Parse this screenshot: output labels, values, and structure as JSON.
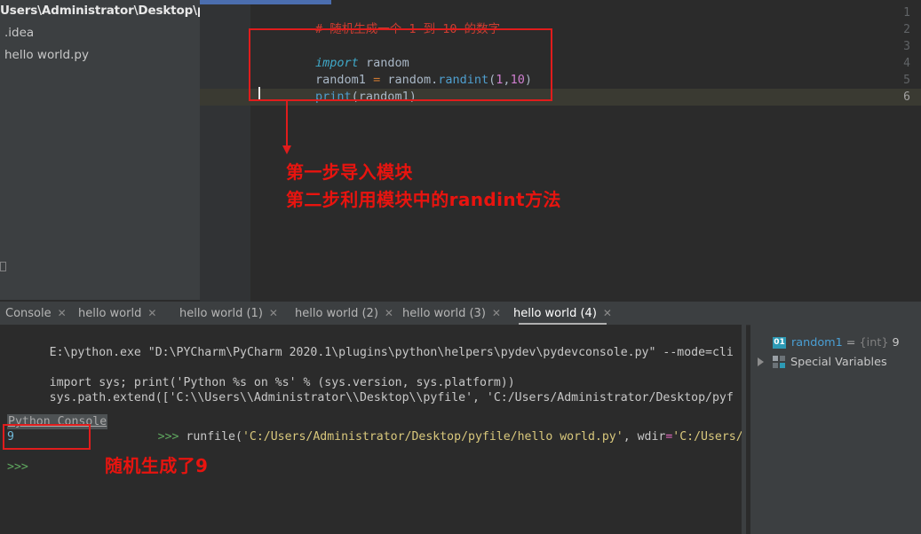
{
  "project_tree": {
    "root": "Users\\Administrator\\Desktop\\pyfile",
    "items": [
      {
        "label": ".idea"
      },
      {
        "label": "hello world.py"
      }
    ]
  },
  "editor": {
    "line_numbers": [
      "1",
      "2",
      "3",
      "4",
      "5",
      "6"
    ],
    "lines": [
      {
        "n": "1",
        "tokens": [
          {
            "t": "# 随机生成一个 1 到 10 的数字",
            "c": "tok-comment"
          }
        ]
      },
      {
        "n": "2",
        "tokens": []
      },
      {
        "n": "3",
        "tokens": [
          {
            "t": "import",
            "c": "tok-kw"
          },
          {
            "t": " random",
            "c": "tok-plain"
          }
        ]
      },
      {
        "n": "4",
        "tokens": [
          {
            "t": "random1 ",
            "c": "tok-plain"
          },
          {
            "t": "=",
            "c": "tok-op"
          },
          {
            "t": " random.",
            "c": "tok-plain"
          },
          {
            "t": "randint",
            "c": "tok-func"
          },
          {
            "t": "(",
            "c": "tok-plain"
          },
          {
            "t": "1",
            "c": "tok-num"
          },
          {
            "t": ",",
            "c": "tok-plain"
          },
          {
            "t": "10",
            "c": "tok-num"
          },
          {
            "t": ")",
            "c": "tok-plain"
          }
        ]
      },
      {
        "n": "5",
        "tokens": [
          {
            "t": "print",
            "c": "tok-func"
          },
          {
            "t": "(random1)",
            "c": "tok-plain"
          }
        ]
      },
      {
        "n": "6",
        "tokens": []
      }
    ]
  },
  "annotations": {
    "editor_note_line1": "第一步导入模块",
    "editor_note_line2": "第二步利用模块中的randint方法",
    "console_note": "随机生成了9",
    "color": "#e8140f"
  },
  "tabs": [
    {
      "label": "Console",
      "active": false
    },
    {
      "label": "hello world",
      "active": false
    },
    {
      "label": "hello world (1)",
      "active": false
    },
    {
      "label": "hello world (2)",
      "active": false
    },
    {
      "label": "hello world (3)",
      "active": false
    },
    {
      "label": "hello world (4)",
      "active": true
    }
  ],
  "tab_close_icon": "✕",
  "console": {
    "python_console_label": "Python Console",
    "lines": [
      {
        "y": 6,
        "parts": [
          {
            "t": "E:\\python.exe \"D:\\PYCharm\\PyCharm 2020.1\\plugins\\python\\helpers\\pydev\\pydevconsole.py\" --mode=cli",
            "c": "c-white"
          }
        ]
      },
      {
        "y": 40,
        "parts": [
          {
            "t": "import sys; print('Python %s on %s' % (sys.version, sys.platform))",
            "c": "c-white"
          }
        ]
      },
      {
        "y": 57,
        "parts": [
          {
            "t": "sys.path.extend(['C:\\\\Users\\\\Administrator\\\\Desktop\\\\pyfile', 'C:/Users/Administrator/Desktop/pyf",
            "c": "c-white"
          }
        ]
      }
    ],
    "runline": {
      "prompt": ">>> ",
      "parts": [
        {
          "t": "runfile(",
          "c": "c-white"
        },
        {
          "t": "'C:/Users/Administrator/Desktop/pyfile/hello world.py'",
          "c": "c-str"
        },
        {
          "t": ", wdir",
          "c": "c-white"
        },
        {
          "t": "=",
          "c": "c-pink"
        },
        {
          "t": "'C:/Users/",
          "c": "c-str"
        }
      ]
    },
    "output_value": "9",
    "final_prompt": ">>>"
  },
  "variables": {
    "rows": [
      {
        "badge": "01",
        "name": "random1",
        "eq": "=",
        "type": "{int}",
        "value": "9",
        "expandable": false
      },
      {
        "badge": "special",
        "name": "Special Variables",
        "expandable": true
      }
    ]
  }
}
